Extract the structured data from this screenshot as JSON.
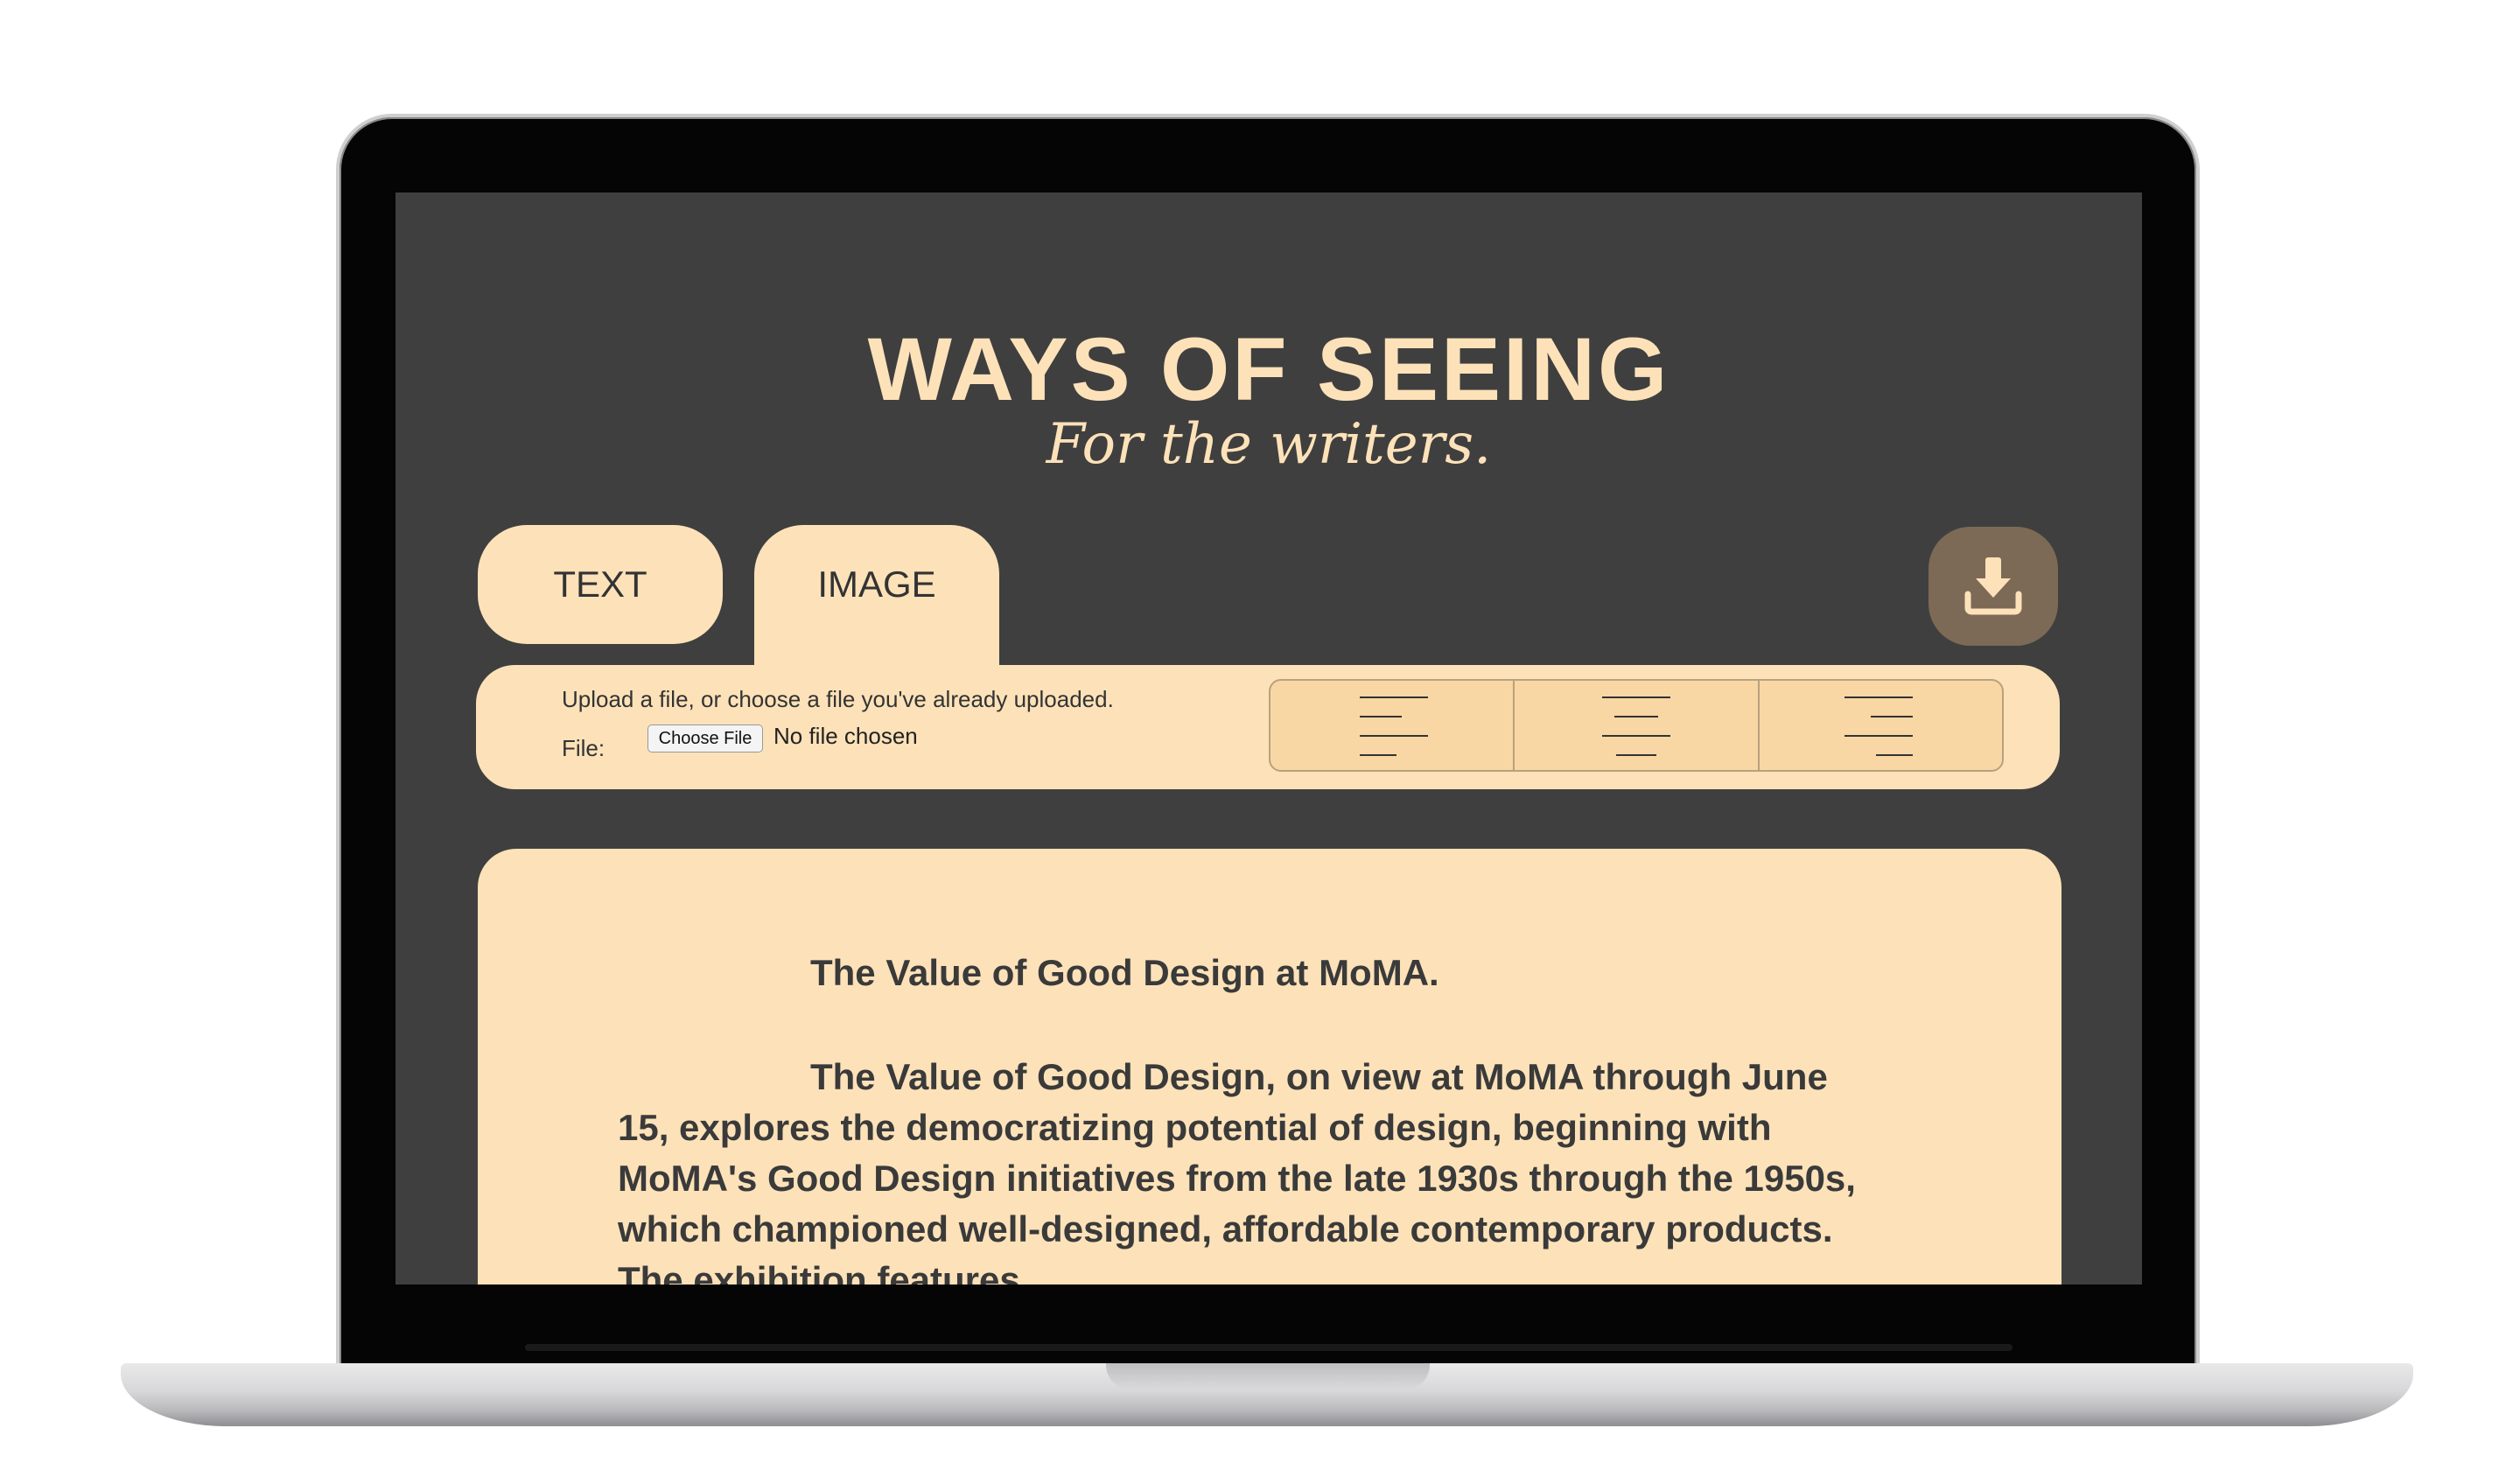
{
  "app": {
    "title": "WAYS OF SEEING",
    "subtitle": "For the writers."
  },
  "tabs": [
    {
      "label": "TEXT",
      "active": false
    },
    {
      "label": "IMAGE",
      "active": true
    }
  ],
  "toolbar": {
    "upload_instructions": "Upload a file, or choose a file you've already uploaded.",
    "file_label": "File:",
    "choose_file_button": "Choose File",
    "file_status": "No file chosen",
    "align_options": [
      "align-left",
      "align-center",
      "align-right"
    ]
  },
  "download_icon": "download-icon",
  "document": {
    "title": "The Value of Good Design at MoMA.",
    "body": "The Value of Good Design, on view at MoMA through June 15, explores the democratizing potential of design, beginning with MoMA's Good Design initiatives from the late 1930s through the 1950s, which championed well-designed, affordable contemporary products. The exhibition features"
  },
  "colors": {
    "background": "#3f3f3f",
    "accent": "#fde2b9",
    "download_button": "#7c6a56",
    "text": "#3a3a3a"
  }
}
